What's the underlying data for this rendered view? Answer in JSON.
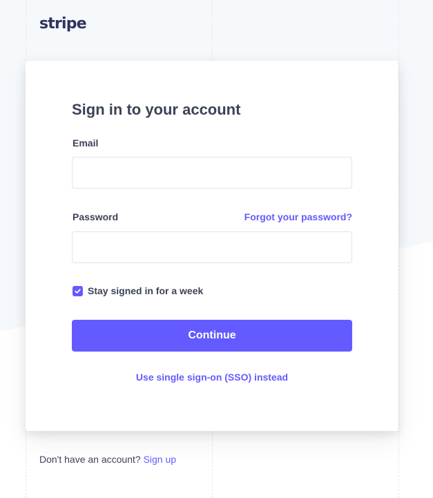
{
  "brand": {
    "logo_text": "stripe",
    "accent_color": "#635bff",
    "button_color": "#635bff",
    "background_tint": "#f6f9fc"
  },
  "signin": {
    "title": "Sign in to your account",
    "email_label": "Email",
    "email_value": "",
    "password_label": "Password",
    "password_value": "",
    "forgot_link": "Forgot your password?",
    "remember_label": "Stay signed in for a week",
    "remember_checked": true,
    "checkmark_icon": "check-icon",
    "continue_button": "Continue",
    "sso_link": "Use single sign-on (SSO) instead"
  },
  "footer": {
    "prompt": "Don't have an account?",
    "signup_link": "Sign up"
  }
}
